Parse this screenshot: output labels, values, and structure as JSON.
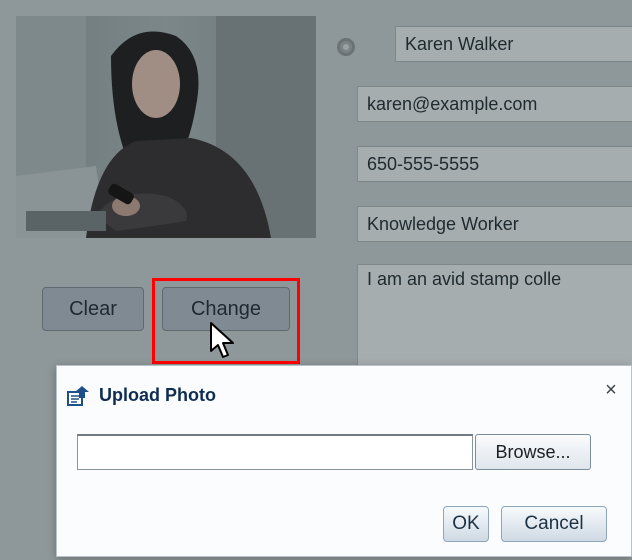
{
  "background_form": {
    "name_value": "Karen Walker",
    "email_value": "karen@example.com",
    "phone_value": "650-555-5555",
    "title_value": "Knowledge Worker",
    "bio_value": "I am an avid stamp colle",
    "clear_label": "Clear",
    "change_label": "Change"
  },
  "dialog": {
    "title": "Upload Photo",
    "close_label": "×",
    "file_path_value": "",
    "browse_label": "Browse...",
    "ok_label": "OK",
    "cancel_label": "Cancel"
  },
  "icons": {
    "upload": "upload-icon",
    "close": "close-icon",
    "cursor": "mouse-pointer-icon"
  },
  "colors": {
    "overlay_bg": "#8e9799",
    "highlight": "#ff0000",
    "dialog_title": "#0e2d51"
  }
}
